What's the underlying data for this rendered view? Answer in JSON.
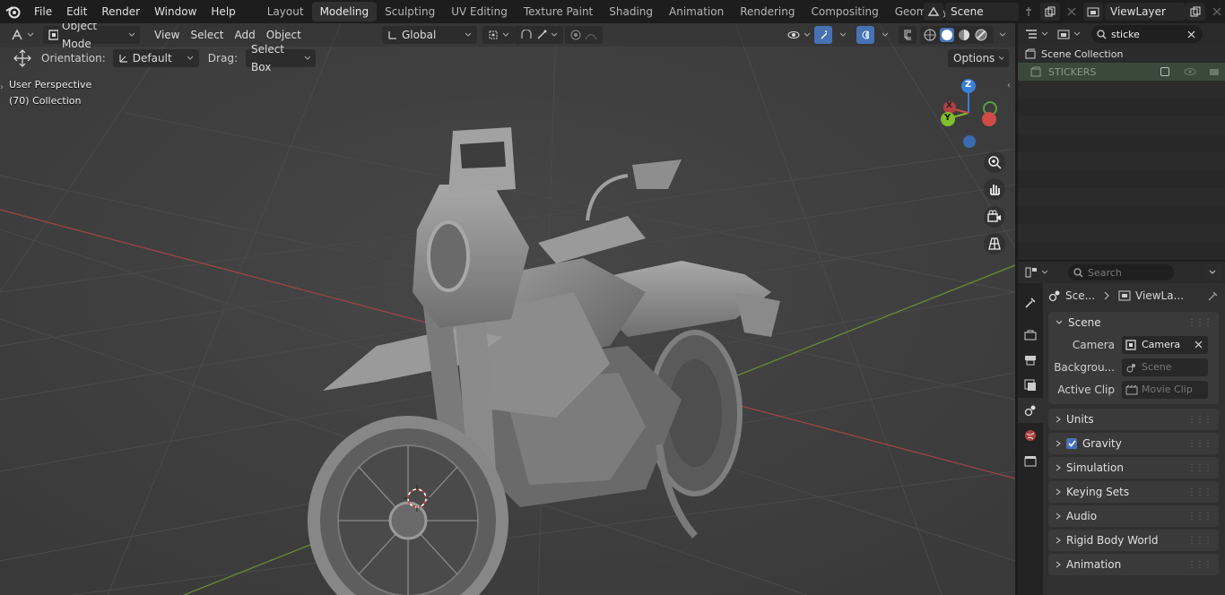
{
  "menus": [
    "File",
    "Edit",
    "Render",
    "Window",
    "Help"
  ],
  "workspaces": [
    "Layout",
    "Modeling",
    "Sculpting",
    "UV Editing",
    "Texture Paint",
    "Shading",
    "Animation",
    "Rendering",
    "Compositing",
    "Geometry Node"
  ],
  "active_workspace": "Modeling",
  "scene_name": "Scene",
  "view_layer_name": "ViewLayer",
  "viewport": {
    "mode": "Object Mode",
    "menu": [
      "View",
      "Select",
      "Add",
      "Object"
    ],
    "transform_orientation": "Global",
    "orientation_label": "Orientation:",
    "orientation_value": "Default",
    "drag_label": "Drag:",
    "drag_value": "Select Box",
    "options_label": "Options",
    "info_line1": "User Perspective",
    "info_line2": "(70) Collection",
    "gizmo_axes": {
      "z": "Z",
      "y": "Y",
      "x": "X"
    }
  },
  "outliner": {
    "search_value": "sticke",
    "root": "Scene Collection",
    "items": [
      {
        "label": "STICKERS"
      }
    ]
  },
  "properties": {
    "search_placeholder": "Search",
    "breadcrumb_scene": "Sce...",
    "breadcrumb_viewlayer": "ViewLa...",
    "scene_panel": {
      "title": "Scene",
      "camera_label": "Camera",
      "camera_value": "Camera",
      "background_label": "Backgrou...",
      "background_value": "Scene",
      "active_clip_label": "Active Clip",
      "active_clip_value": "Movie Clip"
    },
    "panels": [
      {
        "label": "Units"
      },
      {
        "label": "Gravity"
      },
      {
        "label": "Simulation"
      },
      {
        "label": "Keying Sets"
      },
      {
        "label": "Audio"
      },
      {
        "label": "Rigid Body World"
      },
      {
        "label": "Animation"
      }
    ]
  },
  "colors": {
    "x_axis": "#d04a4a",
    "y_axis": "#7fbf2a",
    "z_axis": "#3a7fd8",
    "accent": "#4772b3"
  }
}
